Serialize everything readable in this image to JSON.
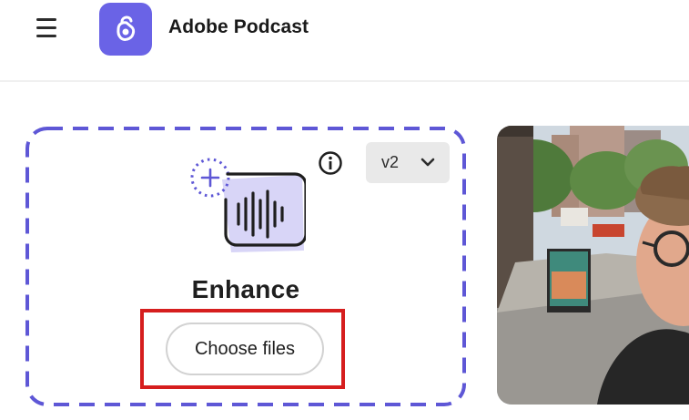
{
  "header": {
    "app_title": "Adobe Podcast",
    "menu_icon": "hamburger-menu-icon",
    "logo_icon": "adobe-podcast-logo"
  },
  "enhance_card": {
    "title": "Enhance",
    "choose_files_label": "Choose files",
    "version_selected": "v2",
    "info_icon": "info-icon",
    "main_icon": "audio-waveform-add-icon"
  },
  "preview": {
    "image": "photo-street-selfie"
  },
  "colors": {
    "accent": "#6a63e6",
    "dashed_border": "#5e57d6",
    "highlight": "#d61e1e",
    "select_bg": "#e9e9e9"
  }
}
